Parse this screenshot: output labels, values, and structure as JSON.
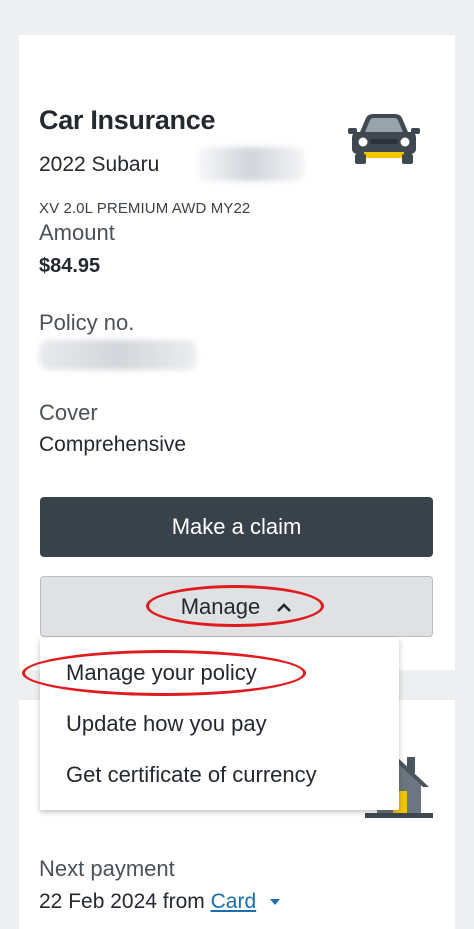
{
  "policy_card": {
    "title": "Car Insurance",
    "vehicle": "2022 Subaru",
    "variant": "XV 2.0L PREMIUM AWD MY22",
    "amount_label": "Amount",
    "amount_value": "$84.95",
    "policy_label": "Policy no.",
    "cover_label": "Cover",
    "cover_value": "Comprehensive",
    "claim_button": "Make a claim",
    "manage_button": "Manage"
  },
  "manage_menu": {
    "items": [
      {
        "label": "Manage your policy"
      },
      {
        "label": "Update how you pay"
      },
      {
        "label": "Get certificate of currency"
      }
    ]
  },
  "payment": {
    "next_label": "Next payment",
    "next_date": "22 Feb 2024 from",
    "method_link": "Card"
  },
  "icons": {
    "car": "car-icon",
    "house": "house-icon",
    "chevron": "chevron-up-icon",
    "caret": "caret-down-icon"
  },
  "colors": {
    "primary_button": "#38424b",
    "secondary_button": "#dfe1e3",
    "link": "#1a6fb0",
    "accent_yellow": "#f3c500",
    "annotation": "#e01a1f"
  }
}
